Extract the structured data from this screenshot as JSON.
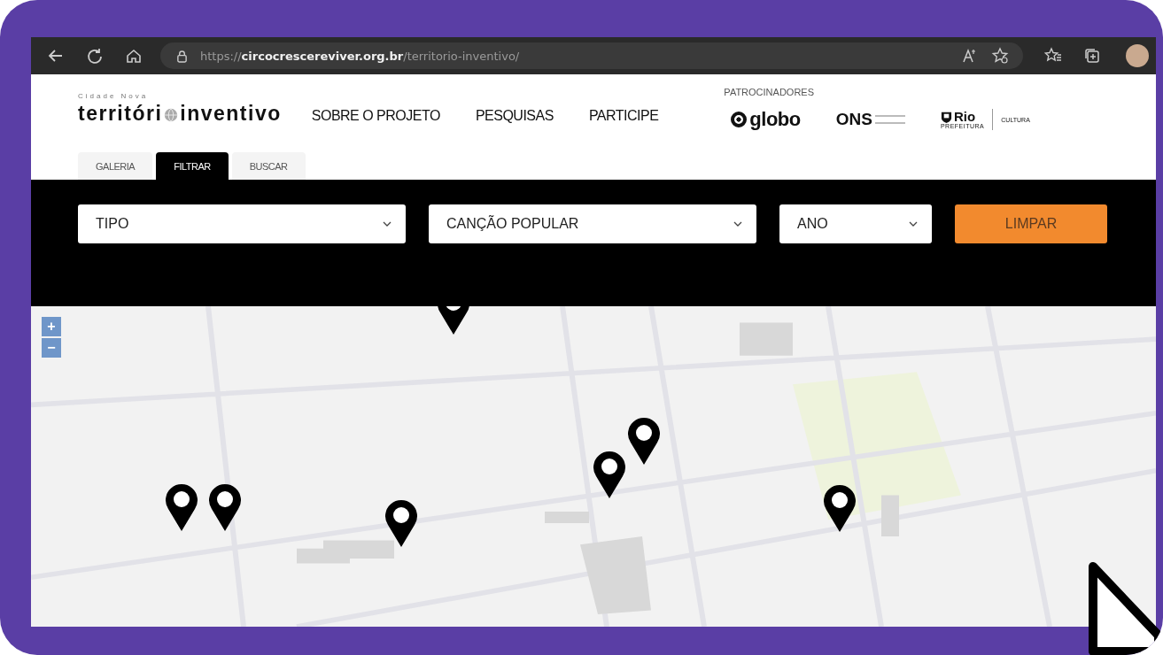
{
  "browser": {
    "url": "https://**circocrescereviver.org.br**/territorio-inventivo/"
  },
  "site": {
    "logo": {
      "tagline": "Cidade Nova",
      "word_1": "territóri",
      "word_2": "inventivo"
    },
    "nav": [
      "SOBRE O PROJETO",
      "PESQUISAS",
      "PARTICIPE"
    ],
    "sponsors": {
      "heading": "PATROCINADORES",
      "logos": [
        {
          "kind": "globo",
          "text": "globo"
        },
        {
          "kind": "ons",
          "text": "ONS"
        },
        {
          "kind": "rio",
          "text": "Rio",
          "subtext": "PREFEITURA",
          "side": "CULTURA"
        }
      ]
    }
  },
  "tabs": [
    {
      "label": "GALERIA",
      "selected": false
    },
    {
      "label": "FILTRAR",
      "selected": true
    },
    {
      "label": "BUSCAR",
      "selected": false
    }
  ],
  "filters": [
    {
      "value": "TIPO"
    },
    {
      "value": "CANÇÃO POPULAR"
    },
    {
      "value": "ANO"
    }
  ],
  "clear_button": "LIMPAR",
  "map": {
    "zoom_in": "+",
    "zoom_out": "−"
  }
}
